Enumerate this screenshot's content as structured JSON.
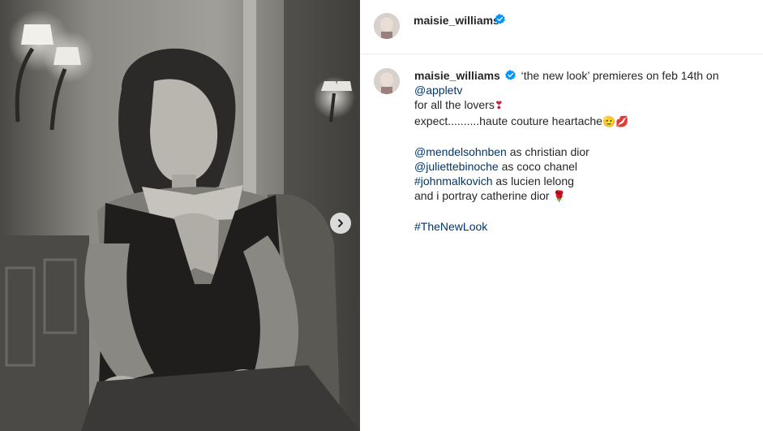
{
  "post": {
    "author": "maisie_williams",
    "next_button": "Next",
    "caption": {
      "author": "maisie_williams",
      "line1_text": "‘the new look’ premieres on feb 14th on",
      "line2_mention": "@appletv",
      "line3_text": "for all the lovers",
      "line3_emoji": "❣",
      "line4_text": "expect..........haute couture heartache",
      "line4_emoji": "🫡💋",
      "line5_mention": "@mendelsohnben",
      "line5_text": " as christian dior",
      "line6_mention": "@juliettebinoche",
      "line6_text": " as coco chanel",
      "line7_mention": "#johnmalkovich",
      "line7_text": " as lucien lelong",
      "line8_text": "and i portray catherine dior ",
      "line8_emoji": "🌹",
      "line9_mention": "#TheNewLook"
    }
  },
  "colors": {
    "verified": "#0095f6",
    "link": "#00376b",
    "text": "#262626"
  },
  "icons": [
    "verified-badge-icon",
    "chevron-right-icon"
  ]
}
